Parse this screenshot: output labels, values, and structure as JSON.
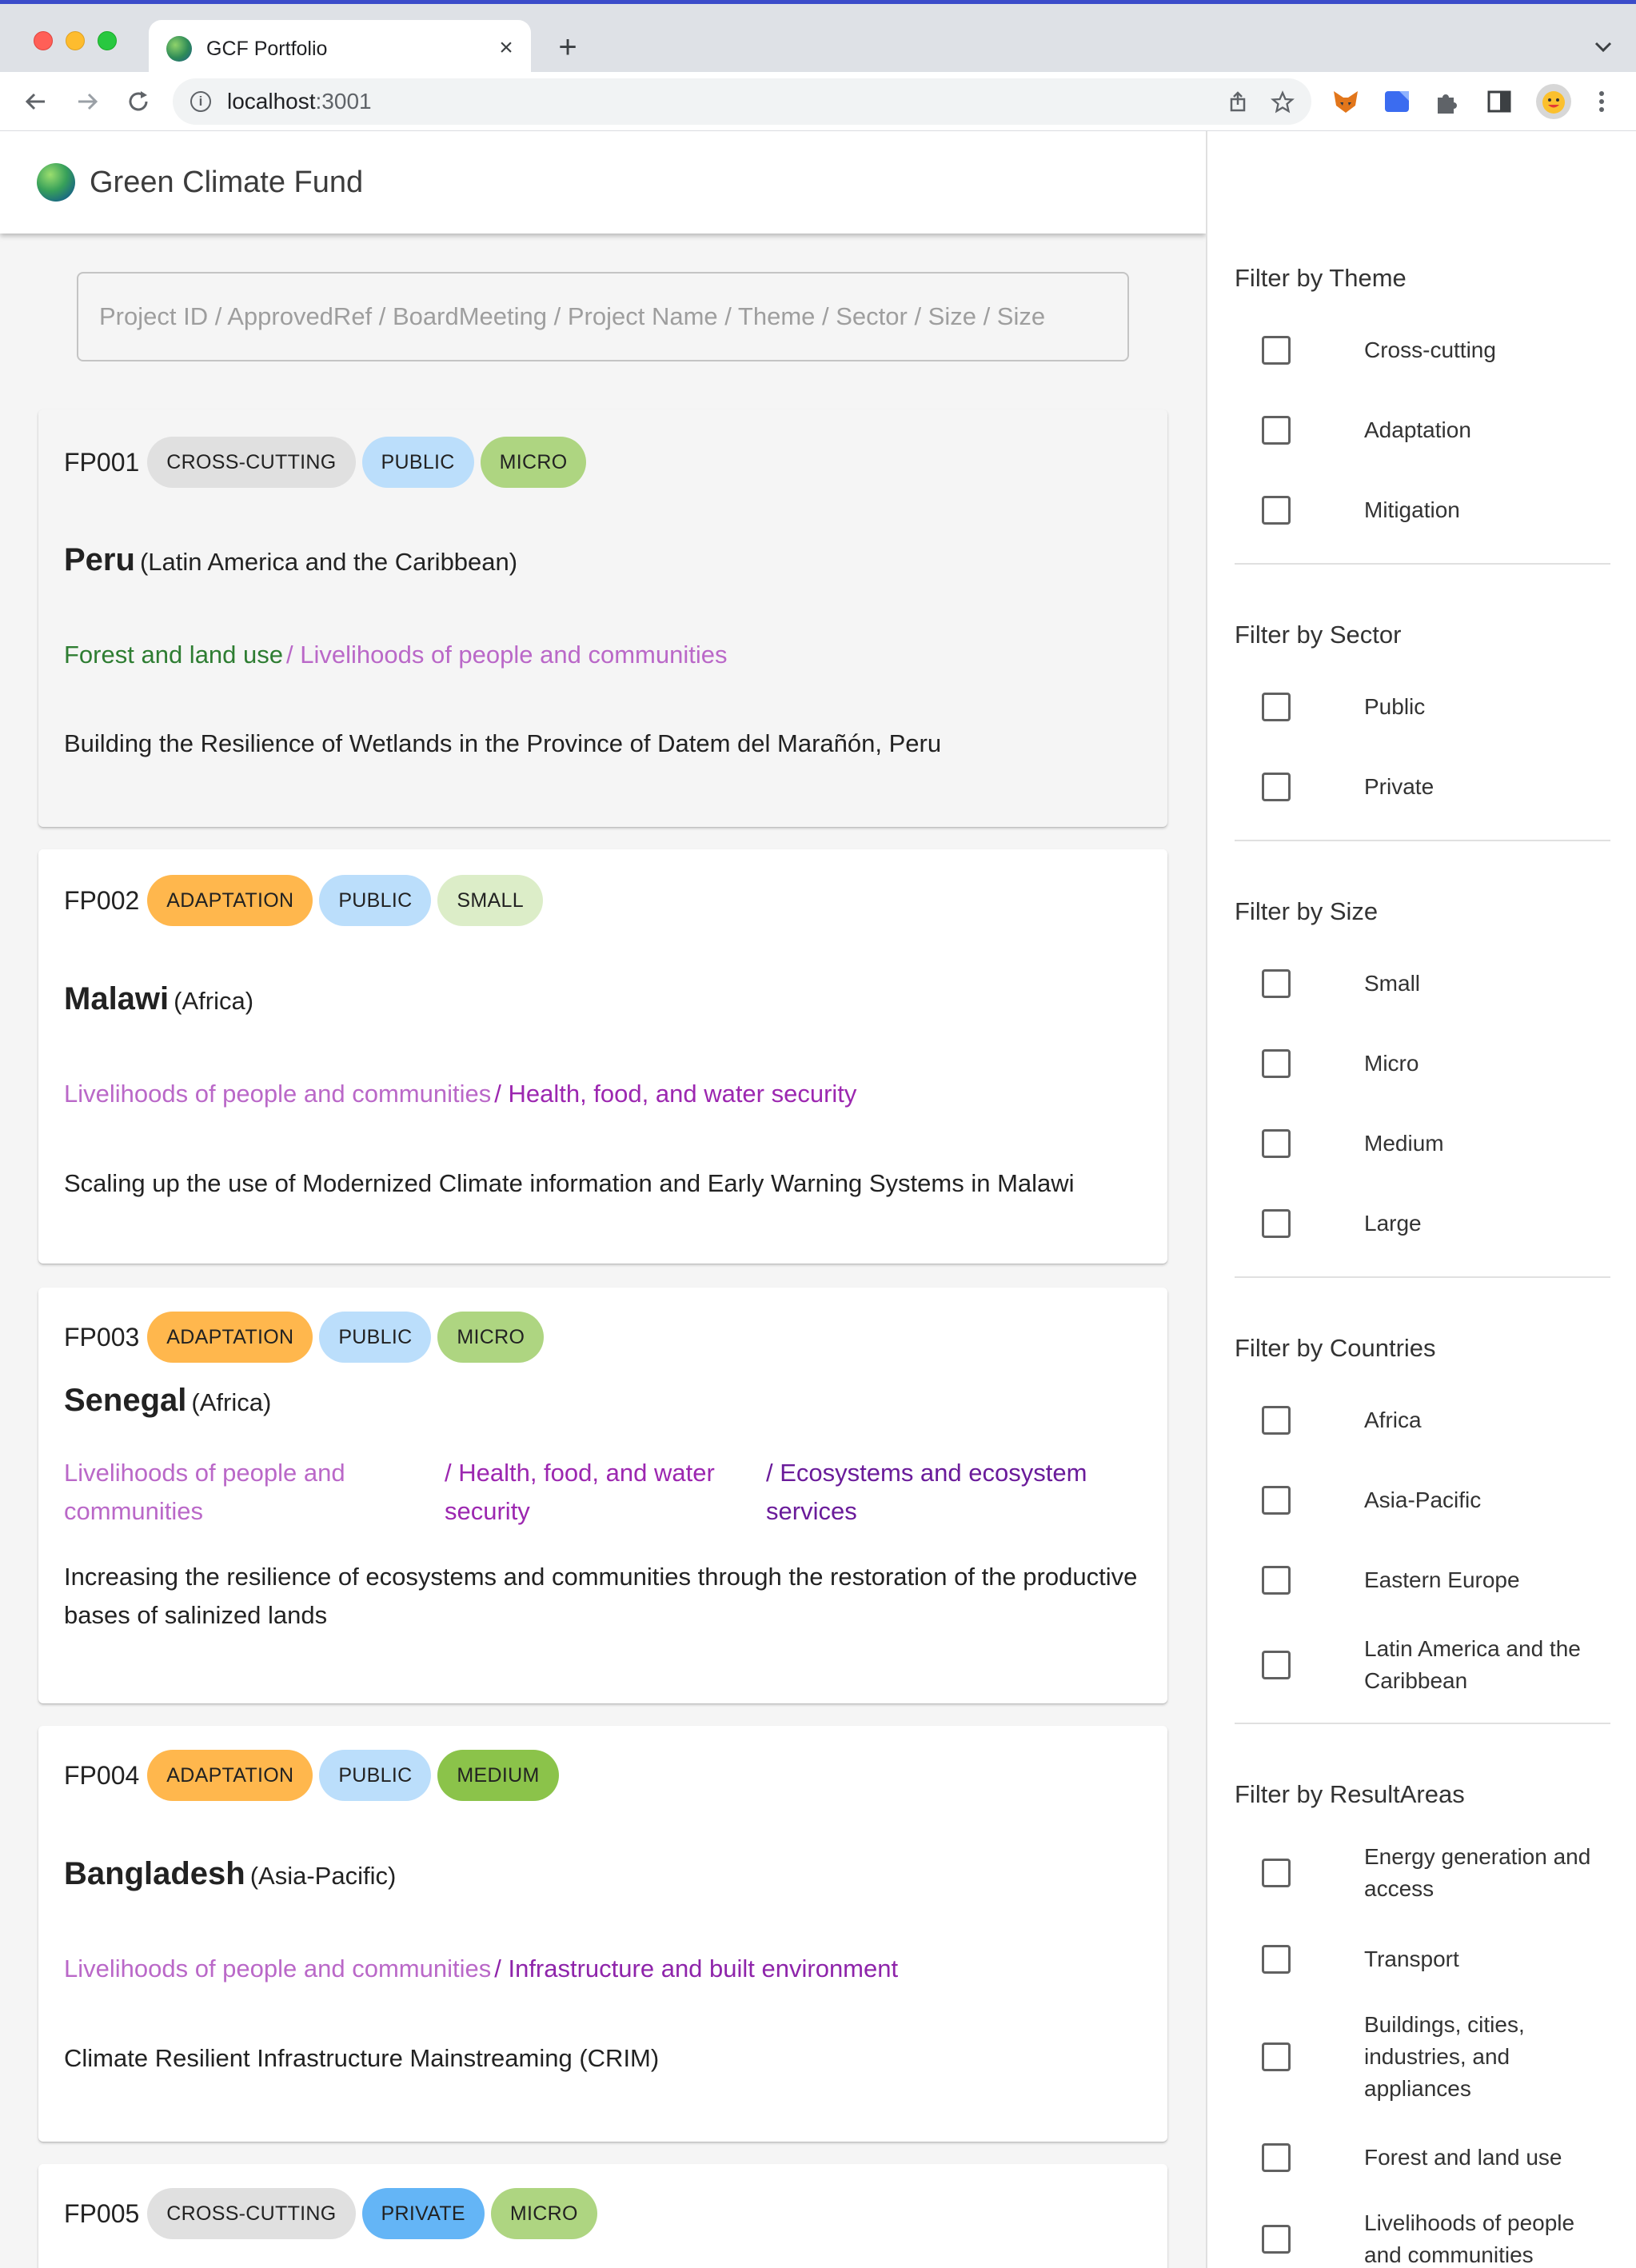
{
  "browser": {
    "tab_title": "GCF Portfolio",
    "tab_close": "×",
    "new_tab": "+",
    "url_host": "localhost",
    "url_port": ":3001",
    "back": "←",
    "forward": "→",
    "reload": "↻",
    "icons": [
      "back-arrow-icon",
      "forward-arrow-icon",
      "reload-icon",
      "site-info-icon",
      "share-icon",
      "bookmark-star-icon",
      "metamask-fox-icon",
      "extension-icon",
      "puzzle-icon",
      "side-panel-icon",
      "profile-avatar-icon",
      "more-menu-icon"
    ]
  },
  "app": {
    "title": "Green Climate Fund",
    "search_placeholder": "Project ID / ApprovedRef / BoardMeeting / Project Name / Theme / Sector / Size / Size"
  },
  "colors": {
    "cross_cutting": "#e0e0e0",
    "adaptation": "#ffb74d",
    "public": "#bbdefb",
    "private": "#64b5f6",
    "micro": "#aed581",
    "small": "#dcedc8",
    "medium": "#8bc34a",
    "forest_area": "#2e7d32",
    "livelihoods_area": "#ba68c8",
    "health_area": "#9c27b0",
    "ecosystems_area": "#6a1b9a",
    "infrastructure_area": "#8e24aa"
  },
  "projects": [
    {
      "id": "FP001",
      "chips": [
        "CROSS-CUTTING",
        "PUBLIC",
        "MICRO"
      ],
      "country": "Peru",
      "region": "(Latin America and the Caribbean)",
      "areas": [
        "Forest and land use",
        "/ Livelihoods of people and communities"
      ],
      "name": "Building the Resilience of Wetlands in the Province of Datem del Marañón, Peru"
    },
    {
      "id": "FP002",
      "chips": [
        "ADAPTATION",
        "PUBLIC",
        "SMALL"
      ],
      "country": "Malawi",
      "region": "(Africa)",
      "areas": [
        "Livelihoods of people and communities",
        "/ Health, food, and water security"
      ],
      "name": "Scaling up the use of Modernized Climate information and Early Warning Systems in Malawi"
    },
    {
      "id": "FP003",
      "chips": [
        "ADAPTATION",
        "PUBLIC",
        "MICRO"
      ],
      "country": "Senegal",
      "region": "(Africa)",
      "areas": [
        "Livelihoods of people and communities",
        "/ Health, food, and water security",
        "/ Ecosystems and ecosystem services"
      ],
      "name": "Increasing the resilience of ecosystems and communities through the restoration of the productive bases of salinized lands"
    },
    {
      "id": "FP004",
      "chips": [
        "ADAPTATION",
        "PUBLIC",
        "MEDIUM"
      ],
      "country": "Bangladesh",
      "region": "(Asia-Pacific)",
      "areas": [
        "Livelihoods of people and communities",
        "/ Infrastructure and built environment"
      ],
      "name": "Climate Resilient Infrastructure Mainstreaming (CRIM)"
    },
    {
      "id": "FP005",
      "chips": [
        "CROSS-CUTTING",
        "PRIVATE",
        "MICRO"
      ]
    }
  ],
  "filters": {
    "theme": {
      "title": "Filter by Theme",
      "options": [
        "Cross-cutting",
        "Adaptation",
        "Mitigation"
      ]
    },
    "sector": {
      "title": "Filter by Sector",
      "options": [
        "Public",
        "Private"
      ]
    },
    "size": {
      "title": "Filter by Size",
      "options": [
        "Small",
        "Micro",
        "Medium",
        "Large"
      ]
    },
    "countries": {
      "title": "Filter by Countries",
      "options": [
        "Africa",
        "Asia-Pacific",
        "Eastern Europe",
        "Latin America and the Caribbean"
      ]
    },
    "result_areas": {
      "title": "Filter by ResultAreas",
      "options": [
        "Energy generation and access",
        "Transport",
        "Buildings, cities, industries, and appliances",
        "Forest and land use",
        "Livelihoods of people and communities"
      ]
    }
  }
}
